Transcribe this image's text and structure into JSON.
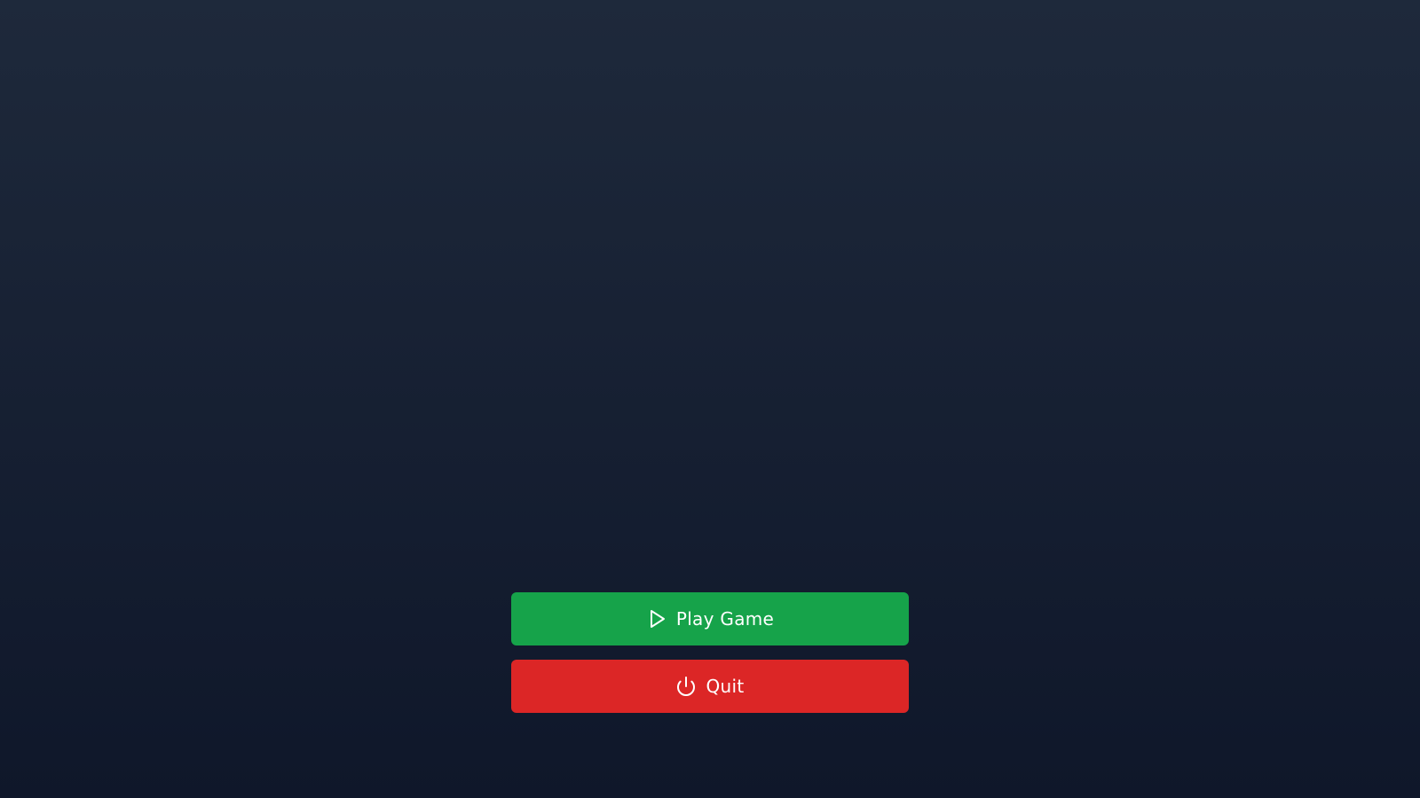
{
  "menu": {
    "buttons": [
      {
        "label": "Play Game",
        "icon": "play-icon",
        "color": "#16a34a"
      },
      {
        "label": "Quit",
        "icon": "power-icon",
        "color": "#dc2626"
      }
    ]
  },
  "theme": {
    "background_top": "#1e293b",
    "background_bottom": "#0f172a",
    "text_color": "#ffffff"
  }
}
